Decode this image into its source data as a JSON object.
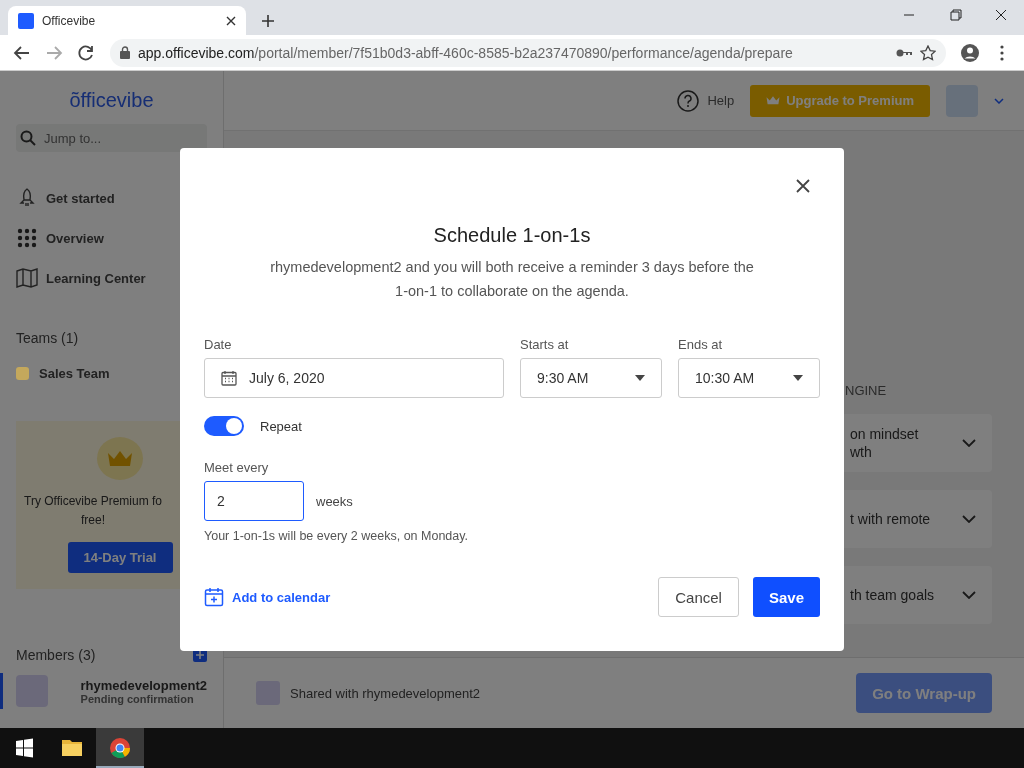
{
  "browser": {
    "tab_title": "Officevibe",
    "url_host": "app.officevibe.com",
    "url_path": "/portal/member/7f51b0d3-abff-460c-8585-b2a237470890/performance/agenda/prepare"
  },
  "sidebar": {
    "logo": "õfficevibe",
    "search_placeholder": "Jump to...",
    "nav": [
      {
        "label": "Get started",
        "kind": "rocket"
      },
      {
        "label": "Overview",
        "kind": "grid"
      },
      {
        "label": "Learning Center",
        "kind": "book"
      }
    ],
    "teams_heading": "Teams (1)",
    "teams": [
      {
        "label": "Sales Team",
        "color": "#c4a85c"
      }
    ],
    "promo": {
      "lines": [
        "Try Officevibe Premium fo",
        "free!"
      ],
      "button": "14-Day Trial"
    },
    "members_heading": "Members (3)",
    "members": [
      {
        "name": "rhymedevelopment2",
        "status": "Pending confirmation",
        "selected": true
      }
    ]
  },
  "header": {
    "help": "Help",
    "upgrade": "Upgrade to Premium"
  },
  "main": {
    "section_label": "NGINE",
    "cards": [
      {
        "lines": [
          "on mindset",
          "wth"
        ]
      },
      {
        "lines": [
          "t with remote"
        ]
      },
      {
        "lines": [
          "th team goals"
        ]
      }
    ],
    "shared": "Shared with rhymedevelopment2",
    "wrap_button": "Go to Wrap-up"
  },
  "modal": {
    "title": "Schedule 1-on-1s",
    "description": "rhymedevelopment2 and you will both receive a reminder 3 days before the 1-on-1 to collaborate on the agenda.",
    "date_label": "Date",
    "date_value": "July 6, 2020",
    "starts_label": "Starts at",
    "starts_value": "9:30 AM",
    "ends_label": "Ends at",
    "ends_value": "10:30 AM",
    "repeat": {
      "label": "Repeat",
      "on": true
    },
    "meet_label": "Meet every",
    "meet_value": "2",
    "unit": "weeks",
    "summary": "Your 1-on-1s will be every 2 weeks, on Monday.",
    "add_calendar": "Add to calendar",
    "cancel": "Cancel",
    "save": "Save"
  }
}
